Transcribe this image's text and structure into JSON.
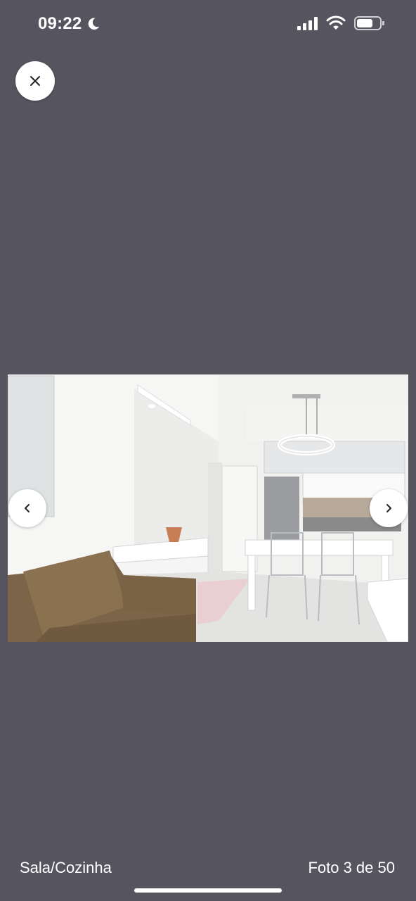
{
  "status_bar": {
    "time": "09:22",
    "icons": [
      "moon-icon",
      "signal-icon",
      "wifi-icon",
      "battery-icon"
    ]
  },
  "viewer": {
    "close_icon": "close-icon",
    "prev_icon": "chevron-left-icon",
    "next_icon": "chevron-right-icon",
    "caption": "Sala/Cozinha",
    "counter": "Foto 3 de 50",
    "current_photo": 3,
    "total_photos": 50
  },
  "colors": {
    "background": "#56555f",
    "button": "#ffffff",
    "text": "#ffffff"
  }
}
